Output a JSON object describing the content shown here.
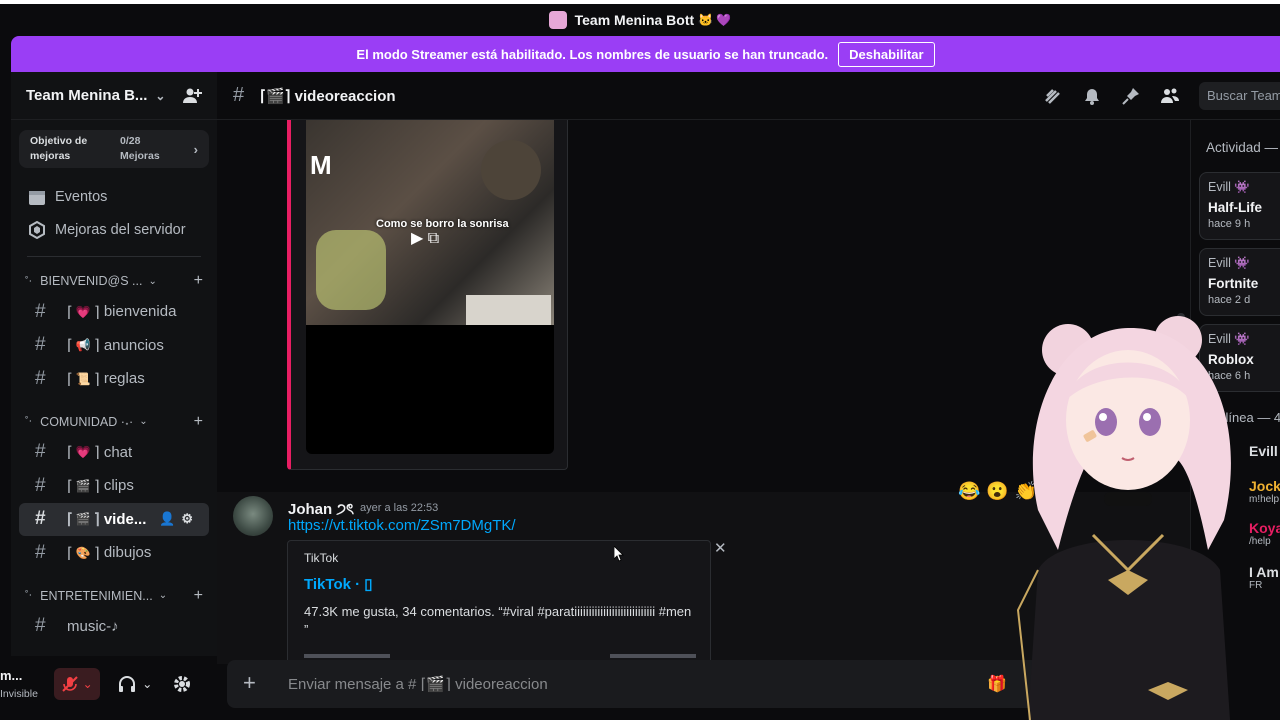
{
  "window": {
    "title": "Team Menina Bott",
    "title_emoji": "🐱 💜"
  },
  "notice": {
    "text": "El modo Streamer está habilitado. Los nombres de usuario se han truncado.",
    "button": "Deshabilitar"
  },
  "server": {
    "name": "Team Menina B...",
    "boost_goal_label": "Objetivo de mejoras",
    "boost_progress": "0/28 Mejoras",
    "menu": [
      {
        "label": "Eventos",
        "icon": "calendar-icon"
      },
      {
        "label": "Mejoras del servidor",
        "icon": "boost-gem-icon"
      }
    ],
    "categories": [
      {
        "name": "BIENVENID@S ...",
        "channels": [
          {
            "emoji": "💗",
            "name": "bienvenida"
          },
          {
            "emoji": "📢",
            "name": "anuncios"
          },
          {
            "emoji": "📜",
            "name": "reglas"
          }
        ]
      },
      {
        "name": "COMUNIDAD ·˖·",
        "channels": [
          {
            "emoji": "💗",
            "name": "chat"
          },
          {
            "emoji": "🎬",
            "name": "clips"
          },
          {
            "emoji": "🎬",
            "name": "vide...",
            "active": true
          },
          {
            "emoji": "🎨",
            "name": "dibujos"
          }
        ]
      },
      {
        "name": "ENTRETENIMIEN...",
        "channels": [
          {
            "emoji": "",
            "name": "music-♪"
          }
        ]
      }
    ]
  },
  "user": {
    "name": "m...",
    "status": "Invisible"
  },
  "channel": {
    "title": "⌈🎬⌉ videoreaccion",
    "search_placeholder": "Buscar Team"
  },
  "embed_video": {
    "caption": "Como se borro la sonrisa"
  },
  "message": {
    "author": "Johan ੭ৎ",
    "timestamp": "ayer a las 22:53",
    "link": "https://vt.tiktok.com/ZSm7DMgTK/",
    "embed": {
      "provider": "TikTok",
      "title": "TikTok · ▯",
      "description": "47.3K me gusta, 34 comentarios. “#viral #paratiiiiiiiiiiiiiiiiiiiiiiiiiiii #men ”"
    }
  },
  "composer": {
    "placeholder": "Enviar mensaje a # ⌈🎬⌉ videoreaccion"
  },
  "activity": {
    "header": "Actividad —",
    "cards": [
      {
        "user": "Evill 👾",
        "game": "Half-Life",
        "time": "hace 9 h"
      },
      {
        "user": "Evill 👾",
        "game": "Fortnite",
        "time": "hace 2 d"
      },
      {
        "user": "Evill 👾",
        "game": "Roblox",
        "time": "hace 6 h"
      }
    ],
    "online_header": "En línea — 4",
    "members": [
      {
        "name": "Evill",
        "sub": "",
        "color": "#dbdee1"
      },
      {
        "name": "Jock",
        "sub": "m!help",
        "color": "#f0b232"
      },
      {
        "name": "Koya",
        "sub": "/help",
        "color": "#e91e63"
      },
      {
        "name": "I Am",
        "sub": "FR",
        "color": "#dbdee1"
      }
    ]
  },
  "reactions": [
    "😂",
    "😮",
    "👏"
  ],
  "colors": {
    "accent": "#9a3ef5",
    "link": "#00a8fc",
    "embed_border": "#e91e63",
    "danger": "#f23f43"
  }
}
